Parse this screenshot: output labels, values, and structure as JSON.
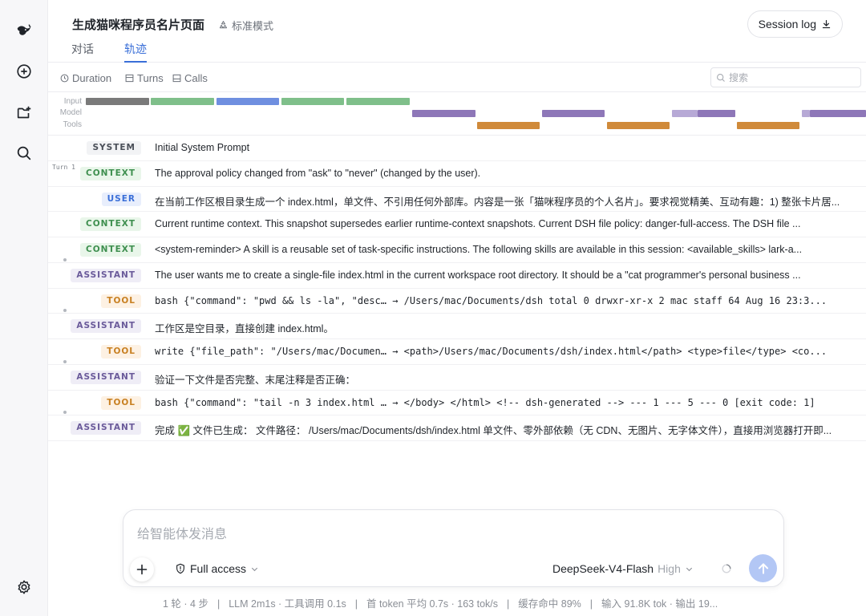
{
  "header": {
    "title": "生成猫咪程序员名片页面",
    "mode_label": "标准模式",
    "session_log_label": "Session log",
    "tabs": [
      {
        "label": "对话",
        "active": false
      },
      {
        "label": "轨迹",
        "active": true
      }
    ]
  },
  "filters": {
    "duration": "Duration",
    "turns": "Turns",
    "calls": "Calls",
    "search_placeholder": "搜索"
  },
  "timeline": {
    "labels": [
      "Input",
      "Model",
      "Tools"
    ]
  },
  "rows": [
    {
      "role": "SYSTEM",
      "text": "Initial System Prompt"
    },
    {
      "role": "CONTEXT",
      "turn": "Turn 1",
      "text": "The approval policy changed from \"ask\" to \"never\" (changed by the user)."
    },
    {
      "role": "USER",
      "text": "在当前工作区根目录生成一个 index.html，单文件、不引用任何外部库。内容是一张「猫咪程序员的个人名片」。要求视觉精美、互动有趣：1) 整张卡片居..."
    },
    {
      "role": "CONTEXT",
      "text": "Current runtime context. This snapshot supersedes earlier runtime-context snapshots. Current DSH file policy: danger-full-access. The DSH file ..."
    },
    {
      "role": "CONTEXT",
      "text": "<system-reminder> A skill is a reusable set of task-specific instructions. The following skills are available in this session: <available_skills> lark-a..."
    },
    {
      "role": "ASSISTANT",
      "text": "The user wants me to create a single-file index.html in the current workspace root directory. It should be a \"cat programmer's personal business ..."
    },
    {
      "role": "TOOL",
      "text": "bash {\"command\": \"pwd && ls -la\", \"desc… → /Users/mac/Documents/dsh total 0 drwxr-xr-x 2 mac staff 64 Aug 16 23:3..."
    },
    {
      "role": "ASSISTANT",
      "text": "工作区是空目录，直接创建 index.html。"
    },
    {
      "role": "TOOL",
      "text": "write {\"file_path\": \"/Users/mac/Documen… → <path>/Users/mac/Documents/dsh/index.html</path> <type>file</type> <co..."
    },
    {
      "role": "ASSISTANT",
      "text": "验证一下文件是否完整、末尾注释是否正确："
    },
    {
      "role": "TOOL",
      "text": "bash {\"command\": \"tail -n 3 index.html … → </body> </html> <!-- dsh-generated --> --- 1 --- 5 --- 0 [exit code: 1]"
    },
    {
      "role": "ASSISTANT",
      "text": "完成 ✅ 文件已生成： 文件路径： /Users/mac/Documents/dsh/index.html 单文件、零外部依赖（无 CDN、无图片、无字体文件），直接用浏览器打开即..."
    }
  ],
  "composer": {
    "placeholder": "给智能体发消息",
    "access_label": "Full access",
    "model_name": "DeepSeek-V4-Flash",
    "model_level": "High"
  },
  "status": {
    "turns": "1 轮 · 4 步",
    "llm": "LLM 2m1s · 工具调用 0.1s",
    "first_token": "首 token 平均 0.7s · 163 tok/s",
    "cache": "缓存命中 89%",
    "io": "输入 91.8K tok · 输出 19..."
  },
  "colors": {
    "accent": "#3a6fd8",
    "input_bar": "#7a7a7a",
    "input_bar_green": "#7fbf8a",
    "input_bar_blue": "#6f8fe0",
    "model_bar": "#8e77b8",
    "tool_bar": "#d08a3a"
  }
}
